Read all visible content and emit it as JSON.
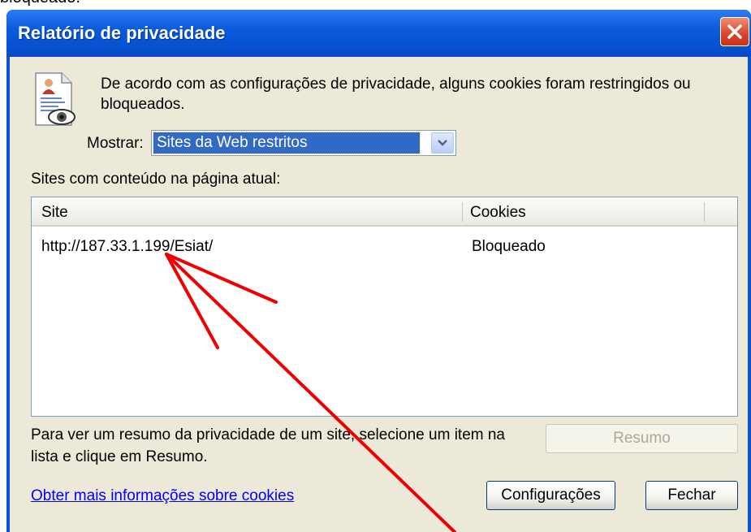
{
  "fragment_top": "bloqueado.",
  "window": {
    "title": "Relatório de privacidade",
    "close_icon": "close-icon"
  },
  "info": {
    "icon": "privacy-report-icon",
    "text": "De acordo com as configurações de privacidade, alguns cookies foram restringidos ou bloqueados."
  },
  "filter": {
    "label": "Mostrar:",
    "selected": "Sites da Web restritos"
  },
  "list": {
    "caption": "Sites com conteúdo na página atual:",
    "columns": [
      "Site",
      "Cookies"
    ],
    "rows": [
      {
        "site": "http://187.33.1.199/Esiat/",
        "cookies": "Bloqueado"
      }
    ]
  },
  "hint": "Para ver um resumo da privacidade de um site, selecione um item na lista e clique em Resumo.",
  "buttons": {
    "resumo": "Resumo",
    "config": "Configurações",
    "fechar": "Fechar"
  },
  "link": "Obter mais informações sobre cookies",
  "annotation": {
    "color": "#ee0000",
    "icon": "red-arrow-annotation"
  }
}
